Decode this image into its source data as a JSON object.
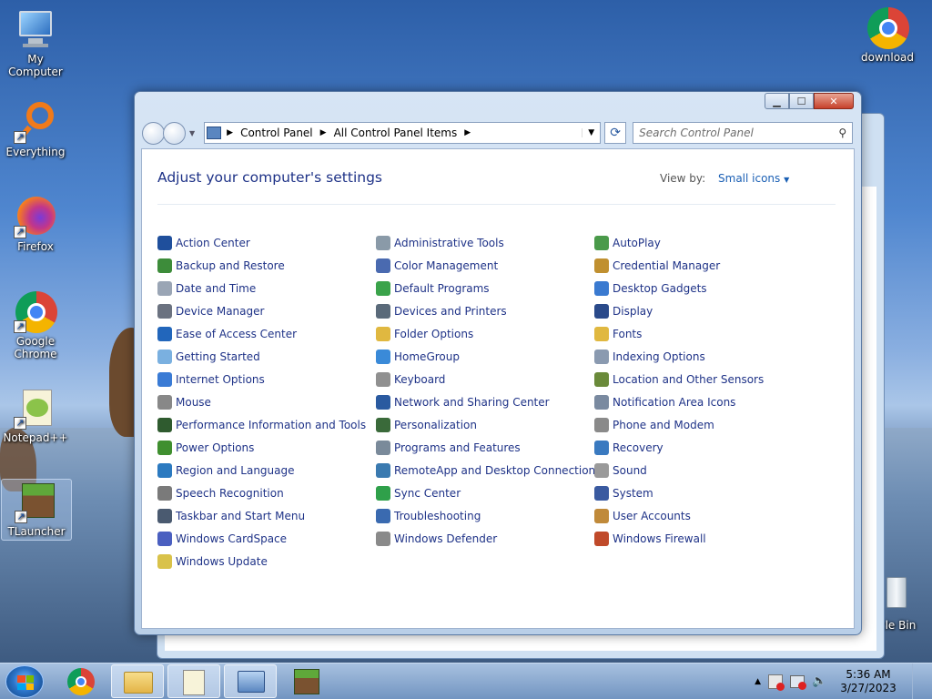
{
  "desktop": {
    "icons": [
      {
        "label": "My Computer"
      },
      {
        "label": "Everything"
      },
      {
        "label": "Firefox"
      },
      {
        "label": "Google Chrome"
      },
      {
        "label": "Notepad++"
      },
      {
        "label": "TLauncher"
      },
      {
        "label": "download"
      },
      {
        "label": "cle Bin"
      }
    ]
  },
  "window": {
    "breadcrumb": [
      "Control Panel",
      "All Control Panel Items"
    ],
    "search_placeholder": "Search Control Panel",
    "heading": "Adjust your computer's settings",
    "view_by_label": "View by:",
    "view_by_value": "Small icons",
    "columns": [
      [
        {
          "label": "Action Center",
          "color": "#1f4f9c"
        },
        {
          "label": "Backup and Restore",
          "color": "#3d8c3a"
        },
        {
          "label": "Date and Time",
          "color": "#9aa5b5"
        },
        {
          "label": "Device Manager",
          "color": "#6b7280"
        },
        {
          "label": "Ease of Access Center",
          "color": "#2266bb"
        },
        {
          "label": "Getting Started",
          "color": "#7ab0e0"
        },
        {
          "label": "Internet Options",
          "color": "#3a7bd5"
        },
        {
          "label": "Mouse",
          "color": "#888888"
        },
        {
          "label": "Performance Information and Tools",
          "color": "#2f5b2f"
        },
        {
          "label": "Power Options",
          "color": "#3f8f2f"
        },
        {
          "label": "Region and Language",
          "color": "#2c7ac0"
        },
        {
          "label": "Speech Recognition",
          "color": "#7a7a7a"
        },
        {
          "label": "Taskbar and Start Menu",
          "color": "#4a5a70"
        },
        {
          "label": "Windows CardSpace",
          "color": "#4a5fc0"
        },
        {
          "label": "Windows Update",
          "color": "#d9c24a"
        }
      ],
      [
        {
          "label": "Administrative Tools",
          "color": "#8a9aa8"
        },
        {
          "label": "Color Management",
          "color": "#4a6ab0"
        },
        {
          "label": "Default Programs",
          "color": "#3aa34a"
        },
        {
          "label": "Devices and Printers",
          "color": "#5a6a7a"
        },
        {
          "label": "Folder Options",
          "color": "#e0b840"
        },
        {
          "label": "HomeGroup",
          "color": "#3a8ad8"
        },
        {
          "label": "Keyboard",
          "color": "#909090"
        },
        {
          "label": "Network and Sharing Center",
          "color": "#2a5aa0"
        },
        {
          "label": "Personalization",
          "color": "#3a6a3a"
        },
        {
          "label": "Programs and Features",
          "color": "#7a8a9a"
        },
        {
          "label": "RemoteApp and Desktop Connections",
          "color": "#3a7ab0"
        },
        {
          "label": "Sync Center",
          "color": "#2fa04a"
        },
        {
          "label": "Troubleshooting",
          "color": "#3a6ab0"
        },
        {
          "label": "Windows Defender",
          "color": "#8a8a8a"
        }
      ],
      [
        {
          "label": "AutoPlay",
          "color": "#4a9a4a"
        },
        {
          "label": "Credential Manager",
          "color": "#c09030"
        },
        {
          "label": "Desktop Gadgets",
          "color": "#3a7ad0"
        },
        {
          "label": "Display",
          "color": "#2a4a8a"
        },
        {
          "label": "Fonts",
          "color": "#e0b840"
        },
        {
          "label": "Indexing Options",
          "color": "#8a9ab0"
        },
        {
          "label": "Location and Other Sensors",
          "color": "#6a8a3a"
        },
        {
          "label": "Notification Area Icons",
          "color": "#7a8aa0"
        },
        {
          "label": "Phone and Modem",
          "color": "#8a8a8a"
        },
        {
          "label": "Recovery",
          "color": "#3a7ac0"
        },
        {
          "label": "Sound",
          "color": "#9a9a9a"
        },
        {
          "label": "System",
          "color": "#3a5aa0"
        },
        {
          "label": "User Accounts",
          "color": "#c08a3a"
        },
        {
          "label": "Windows Firewall",
          "color": "#c04a2a"
        }
      ]
    ]
  },
  "taskbar": {
    "time": "5:36 AM",
    "date": "3/27/2023"
  }
}
